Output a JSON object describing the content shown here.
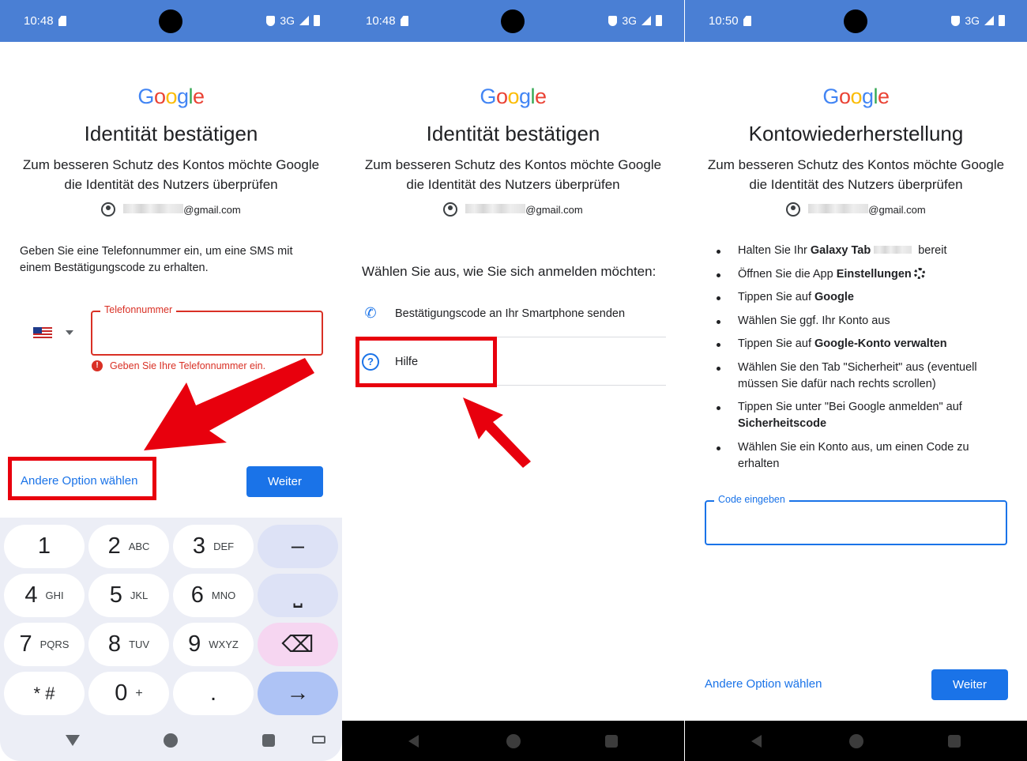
{
  "colors": {
    "statusbar": "#4a7fd4",
    "accent": "#1a73e8",
    "error": "#d93025",
    "annotation": "#e8000d",
    "keyboard_bg": "#eceef6"
  },
  "statusbar": {
    "p1_time": "10:48",
    "p2_time": "10:48",
    "p3_time": "10:50",
    "network": "3G"
  },
  "logo": [
    "G",
    "o",
    "o",
    "g",
    "l",
    "e"
  ],
  "panel1": {
    "title": "Identität bestätigen",
    "subtitle": "Zum besseren Schutz des Kontos möchte Google die Identität des Nutzers überprüfen",
    "account_suffix": "@gmail.com",
    "prompt": "Geben Sie eine Telefonnummer ein, um eine SMS mit einem Bestätigungscode zu erhalten.",
    "phone_label": "Telefonnummer",
    "error": "Geben Sie Ihre Telefonnummer ein.",
    "other_option": "Andere Option wählen",
    "next": "Weiter"
  },
  "keyboard": {
    "keys": [
      {
        "n": "1",
        "l": ""
      },
      {
        "n": "2",
        "l": "ABC"
      },
      {
        "n": "3",
        "l": "DEF"
      },
      {
        "n": "–",
        "l": ""
      },
      {
        "n": "4",
        "l": "GHI"
      },
      {
        "n": "5",
        "l": "JKL"
      },
      {
        "n": "6",
        "l": "MNO"
      },
      {
        "n": "⎵",
        "l": ""
      },
      {
        "n": "7",
        "l": "PQRS"
      },
      {
        "n": "8",
        "l": "TUV"
      },
      {
        "n": "9",
        "l": "WXYZ"
      },
      {
        "n": "⌫",
        "l": ""
      },
      {
        "n": "* #",
        "l": ""
      },
      {
        "n": "0",
        "l": "+"
      },
      {
        "n": ".",
        "l": ""
      },
      {
        "n": "→",
        "l": ""
      }
    ]
  },
  "panel2": {
    "title": "Identität bestätigen",
    "subtitle": "Zum besseren Schutz des Kontos möchte Google die Identität des Nutzers überprüfen",
    "account_suffix": "@gmail.com",
    "choose": "Wählen Sie aus, wie Sie sich anmelden möchten:",
    "option_code": "Bestätigungscode an Ihr Smartphone senden",
    "option_help": "Hilfe"
  },
  "panel3": {
    "title": "Kontowiederherstellung",
    "subtitle": "Zum besseren Schutz des Kontos möchte Google die Identität des Nutzers überprüfen",
    "account_suffix": "@gmail.com",
    "steps": [
      {
        "pre": "Halten Sie Ihr ",
        "bold": "Galaxy Tab",
        "post": " bereit"
      },
      {
        "pre": "Öffnen Sie die App ",
        "bold": "Einstellungen",
        "post": ""
      },
      {
        "pre": "Tippen Sie auf ",
        "bold": "Google",
        "post": ""
      },
      {
        "pre": "Wählen Sie ggf. Ihr Konto aus",
        "bold": "",
        "post": ""
      },
      {
        "pre": "Tippen Sie auf ",
        "bold": "Google-Konto verwalten",
        "post": ""
      },
      {
        "pre": "Wählen Sie den Tab \"Sicherheit\" aus (eventuell müssen Sie dafür nach rechts scrollen)",
        "bold": "",
        "post": ""
      },
      {
        "pre": "Tippen Sie unter \"Bei Google anmelden\" auf ",
        "bold": "Sicherheitscode",
        "post": ""
      },
      {
        "pre": "Wählen Sie ein Konto aus, um einen Code zu erhalten",
        "bold": "",
        "post": ""
      }
    ],
    "code_label": "Code eingeben",
    "other_option": "Andere Option wählen",
    "next": "Weiter"
  }
}
